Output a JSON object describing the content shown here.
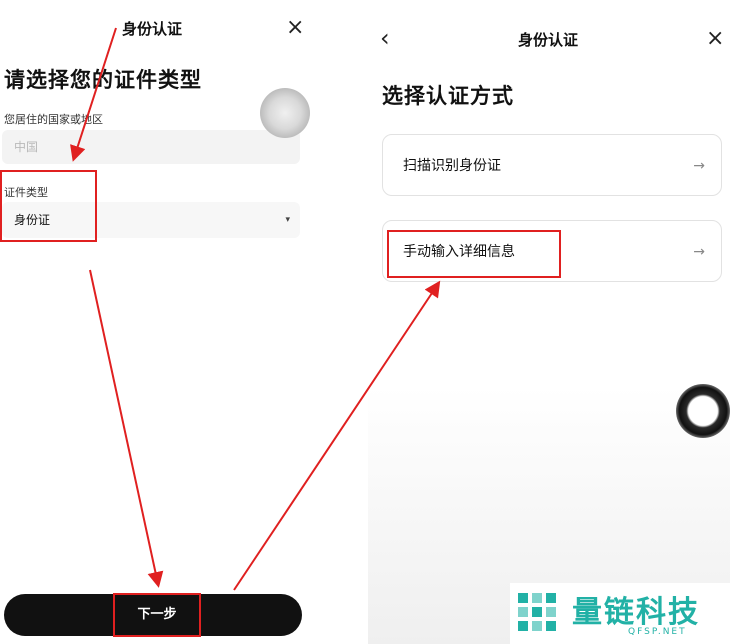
{
  "left": {
    "header_title": "身份认证",
    "page_title": "请选择您的证件类型",
    "country_label": "您居住的国家或地区",
    "country_value": "中国",
    "doc_type_label": "证件类型",
    "doc_type_value": "身份证",
    "next_label": "下一步"
  },
  "right": {
    "header_title": "身份认证",
    "page_title": "选择认证方式",
    "options": [
      {
        "label": "扫描识别身份证",
        "arrow": "→"
      },
      {
        "label": "手动输入详细信息",
        "arrow": "→"
      }
    ]
  },
  "watermark": {
    "brand": "量链科技",
    "site": "QFSP.NET"
  },
  "colors": {
    "annotation_red": "#e02020",
    "button_black": "#111111",
    "watermark_teal": "#22b1a6"
  },
  "icons": {
    "close": "×",
    "back": "‹",
    "caret": "▾"
  }
}
